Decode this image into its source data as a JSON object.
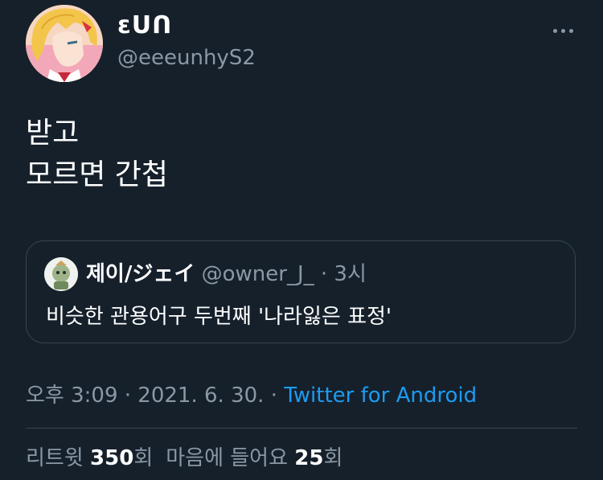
{
  "author": {
    "display_name": "ɛᑌᑎ",
    "handle": "@eeeunhyS2"
  },
  "tweet": {
    "lines": [
      "받고",
      "모르면 간첩"
    ]
  },
  "quote": {
    "name": "제이/ジェイ",
    "handle": "@owner_J_",
    "separator": "·",
    "time": "3시",
    "text": "비슷한 관용어구 두번째 '나라잃은 표정'"
  },
  "meta": {
    "time": "오후 3:09",
    "sep1": "·",
    "date": "2021. 6. 30.",
    "sep2": "·",
    "source": "Twitter for Android"
  },
  "stats": {
    "retweets_label": "리트윗",
    "retweets_count": "350",
    "retweets_unit": "회",
    "likes_label": "마음에 들어요",
    "likes_count": "25",
    "likes_unit": "회"
  },
  "icons": {
    "more": "more-horizontal-icon"
  },
  "colors": {
    "background": "#15202b",
    "text": "#ffffff",
    "secondary": "#8b98a5",
    "link": "#1d9bf0",
    "border": "#38444d"
  }
}
